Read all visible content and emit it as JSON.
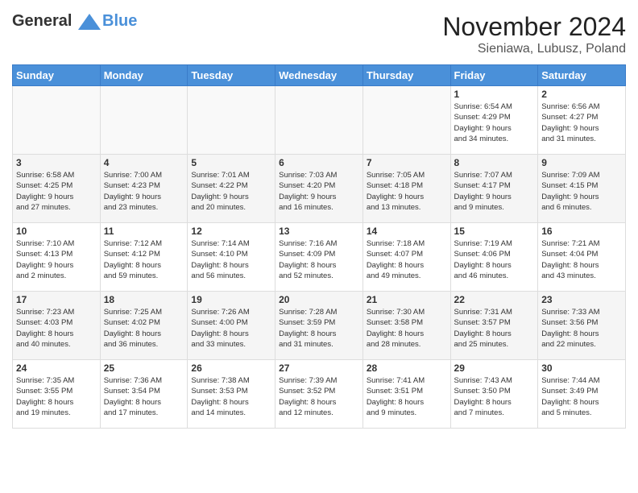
{
  "header": {
    "logo_line1": "General",
    "logo_line2": "Blue",
    "month_title": "November 2024",
    "location": "Sieniawa, Lubusz, Poland"
  },
  "days_of_week": [
    "Sunday",
    "Monday",
    "Tuesday",
    "Wednesday",
    "Thursday",
    "Friday",
    "Saturday"
  ],
  "weeks": [
    [
      {
        "day": "",
        "info": ""
      },
      {
        "day": "",
        "info": ""
      },
      {
        "day": "",
        "info": ""
      },
      {
        "day": "",
        "info": ""
      },
      {
        "day": "",
        "info": ""
      },
      {
        "day": "1",
        "info": "Sunrise: 6:54 AM\nSunset: 4:29 PM\nDaylight: 9 hours\nand 34 minutes."
      },
      {
        "day": "2",
        "info": "Sunrise: 6:56 AM\nSunset: 4:27 PM\nDaylight: 9 hours\nand 31 minutes."
      }
    ],
    [
      {
        "day": "3",
        "info": "Sunrise: 6:58 AM\nSunset: 4:25 PM\nDaylight: 9 hours\nand 27 minutes."
      },
      {
        "day": "4",
        "info": "Sunrise: 7:00 AM\nSunset: 4:23 PM\nDaylight: 9 hours\nand 23 minutes."
      },
      {
        "day": "5",
        "info": "Sunrise: 7:01 AM\nSunset: 4:22 PM\nDaylight: 9 hours\nand 20 minutes."
      },
      {
        "day": "6",
        "info": "Sunrise: 7:03 AM\nSunset: 4:20 PM\nDaylight: 9 hours\nand 16 minutes."
      },
      {
        "day": "7",
        "info": "Sunrise: 7:05 AM\nSunset: 4:18 PM\nDaylight: 9 hours\nand 13 minutes."
      },
      {
        "day": "8",
        "info": "Sunrise: 7:07 AM\nSunset: 4:17 PM\nDaylight: 9 hours\nand 9 minutes."
      },
      {
        "day": "9",
        "info": "Sunrise: 7:09 AM\nSunset: 4:15 PM\nDaylight: 9 hours\nand 6 minutes."
      }
    ],
    [
      {
        "day": "10",
        "info": "Sunrise: 7:10 AM\nSunset: 4:13 PM\nDaylight: 9 hours\nand 2 minutes."
      },
      {
        "day": "11",
        "info": "Sunrise: 7:12 AM\nSunset: 4:12 PM\nDaylight: 8 hours\nand 59 minutes."
      },
      {
        "day": "12",
        "info": "Sunrise: 7:14 AM\nSunset: 4:10 PM\nDaylight: 8 hours\nand 56 minutes."
      },
      {
        "day": "13",
        "info": "Sunrise: 7:16 AM\nSunset: 4:09 PM\nDaylight: 8 hours\nand 52 minutes."
      },
      {
        "day": "14",
        "info": "Sunrise: 7:18 AM\nSunset: 4:07 PM\nDaylight: 8 hours\nand 49 minutes."
      },
      {
        "day": "15",
        "info": "Sunrise: 7:19 AM\nSunset: 4:06 PM\nDaylight: 8 hours\nand 46 minutes."
      },
      {
        "day": "16",
        "info": "Sunrise: 7:21 AM\nSunset: 4:04 PM\nDaylight: 8 hours\nand 43 minutes."
      }
    ],
    [
      {
        "day": "17",
        "info": "Sunrise: 7:23 AM\nSunset: 4:03 PM\nDaylight: 8 hours\nand 40 minutes."
      },
      {
        "day": "18",
        "info": "Sunrise: 7:25 AM\nSunset: 4:02 PM\nDaylight: 8 hours\nand 36 minutes."
      },
      {
        "day": "19",
        "info": "Sunrise: 7:26 AM\nSunset: 4:00 PM\nDaylight: 8 hours\nand 33 minutes."
      },
      {
        "day": "20",
        "info": "Sunrise: 7:28 AM\nSunset: 3:59 PM\nDaylight: 8 hours\nand 31 minutes."
      },
      {
        "day": "21",
        "info": "Sunrise: 7:30 AM\nSunset: 3:58 PM\nDaylight: 8 hours\nand 28 minutes."
      },
      {
        "day": "22",
        "info": "Sunrise: 7:31 AM\nSunset: 3:57 PM\nDaylight: 8 hours\nand 25 minutes."
      },
      {
        "day": "23",
        "info": "Sunrise: 7:33 AM\nSunset: 3:56 PM\nDaylight: 8 hours\nand 22 minutes."
      }
    ],
    [
      {
        "day": "24",
        "info": "Sunrise: 7:35 AM\nSunset: 3:55 PM\nDaylight: 8 hours\nand 19 minutes."
      },
      {
        "day": "25",
        "info": "Sunrise: 7:36 AM\nSunset: 3:54 PM\nDaylight: 8 hours\nand 17 minutes."
      },
      {
        "day": "26",
        "info": "Sunrise: 7:38 AM\nSunset: 3:53 PM\nDaylight: 8 hours\nand 14 minutes."
      },
      {
        "day": "27",
        "info": "Sunrise: 7:39 AM\nSunset: 3:52 PM\nDaylight: 8 hours\nand 12 minutes."
      },
      {
        "day": "28",
        "info": "Sunrise: 7:41 AM\nSunset: 3:51 PM\nDaylight: 8 hours\nand 9 minutes."
      },
      {
        "day": "29",
        "info": "Sunrise: 7:43 AM\nSunset: 3:50 PM\nDaylight: 8 hours\nand 7 minutes."
      },
      {
        "day": "30",
        "info": "Sunrise: 7:44 AM\nSunset: 3:49 PM\nDaylight: 8 hours\nand 5 minutes."
      }
    ]
  ]
}
